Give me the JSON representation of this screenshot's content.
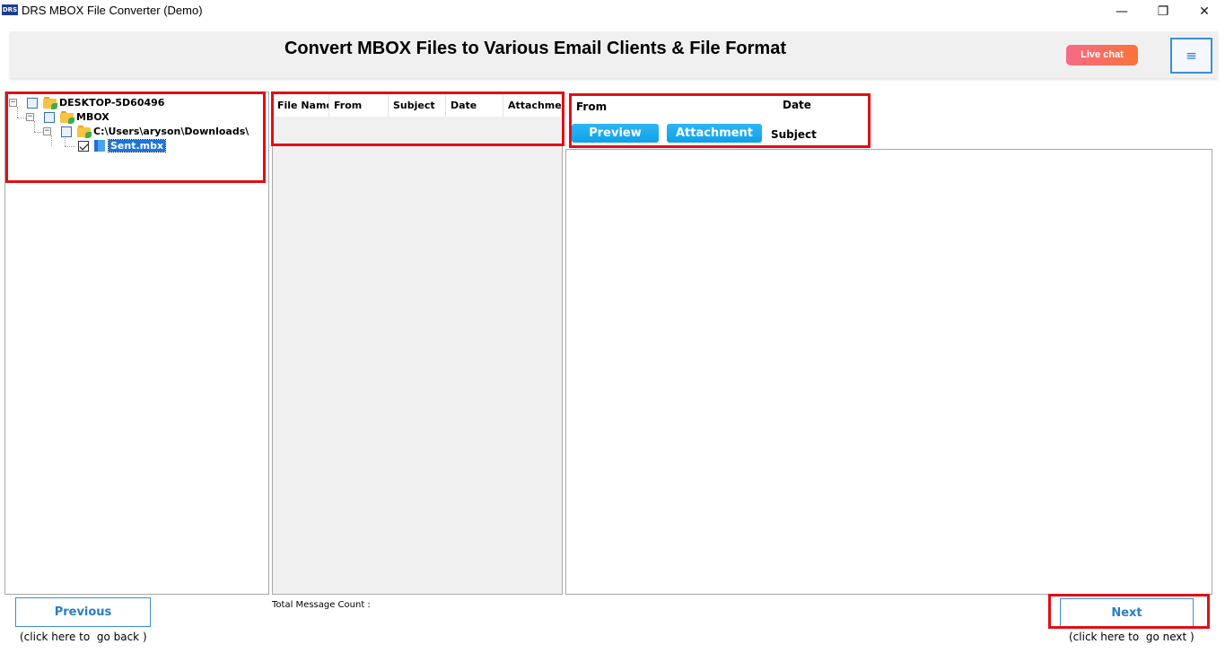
{
  "window": {
    "logo_text": "DRS",
    "title": "DRS MBOX File Converter (Demo)",
    "minimize_glyph": "—",
    "restore_glyph": "❐",
    "close_glyph": "✕"
  },
  "header": {
    "title": "Convert MBOX Files to Various Email Clients & File Format",
    "live_chat_label": "Live chat",
    "menu_icon": "hamburger-icon",
    "menu_glyph": "≡"
  },
  "tree": {
    "nodes": [
      {
        "label": "DESKTOP-5D60496",
        "icon": "computer-folder-icon",
        "checked": false
      },
      {
        "label": "MBOX",
        "icon": "folder-icon",
        "checked": false
      },
      {
        "label": "C:\\Users\\aryson\\Downloads\\",
        "icon": "folder-icon",
        "checked": false
      },
      {
        "label": "Sent.mbx",
        "icon": "mbox-file-icon",
        "checked": true,
        "selected": true
      }
    ],
    "expander_glyph": "−"
  },
  "message_list": {
    "columns": [
      "File Name",
      "From",
      "Subject",
      "Date",
      "Attachment"
    ]
  },
  "preview": {
    "from_label": "From",
    "date_label": "Date",
    "subject_label": "Subject",
    "preview_button": "Preview",
    "attachment_button": "Attachment"
  },
  "footer": {
    "previous_label": "Previous",
    "previous_hint": "(click here to  go back )",
    "next_label": "Next",
    "next_hint": "(click here to  go next )",
    "total_message_count_label": "Total Message Count :"
  },
  "colors": {
    "highlight_red": "#e30d17",
    "accent_blue": "#2b7cc4",
    "button_blue": "#0fa1e9",
    "live_chat_gradient": [
      "#f66a86",
      "#fa7338"
    ]
  }
}
